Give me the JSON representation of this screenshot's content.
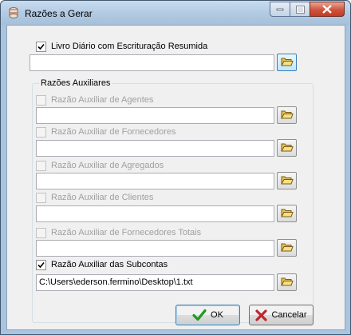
{
  "window": {
    "title": "Razões a Gerar"
  },
  "main": {
    "livro_diario": {
      "label": "Livro Diário com Escrituração Resumida",
      "checked": true,
      "path": ""
    }
  },
  "group": {
    "title": "Razões Auxiliares",
    "items": [
      {
        "label": "Razão Auxiliar de Agentes",
        "checked": false,
        "enabled": false,
        "path": ""
      },
      {
        "label": "Razão Auxiliar de Fornecedores",
        "checked": false,
        "enabled": false,
        "path": ""
      },
      {
        "label": "Razão Auxiliar de Agregados",
        "checked": false,
        "enabled": false,
        "path": ""
      },
      {
        "label": "Razão Auxiliar de Clientes",
        "checked": false,
        "enabled": false,
        "path": ""
      },
      {
        "label": "Razão Auxiliar de Fornecedores Totais",
        "checked": false,
        "enabled": false,
        "path": ""
      },
      {
        "label": "Razão Auxiliar das Subcontas",
        "checked": true,
        "enabled": true,
        "path": "C:\\Users\\ederson.fermino\\Desktop\\1.txt"
      }
    ]
  },
  "buttons": {
    "ok": "OK",
    "cancel": "Cancelar"
  },
  "icons": {
    "app": "app-icon",
    "browse": "folder-open-icon",
    "ok": "checkmark-icon",
    "cancel": "x-icon"
  },
  "colors": {
    "titlebar": "#b3cbe3",
    "close_button": "#c23c25",
    "dialog_bg": "#f0f0f0",
    "ok_icon": "#1f9a1f",
    "cancel_icon": "#c0262b"
  }
}
